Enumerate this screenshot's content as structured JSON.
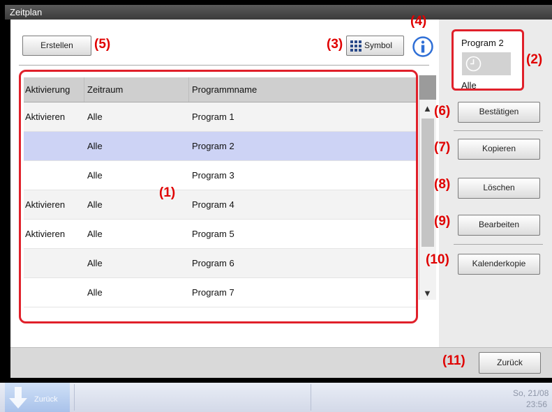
{
  "window": {
    "title": "Zeitplan"
  },
  "toolbar": {
    "create_label": "Erstellen",
    "symbol_label": "Symbol"
  },
  "table": {
    "columns": [
      "Aktivierung",
      "Zeitraum",
      "Programmname"
    ],
    "rows": [
      {
        "activation": "Aktivieren",
        "period": "Alle",
        "name": "Program 1"
      },
      {
        "activation": "",
        "period": "Alle",
        "name": "Program 2"
      },
      {
        "activation": "",
        "period": "Alle",
        "name": "Program 3"
      },
      {
        "activation": "Aktivieren",
        "period": "Alle",
        "name": "Program 4"
      },
      {
        "activation": "Aktivieren",
        "period": "Alle",
        "name": "Program 5"
      },
      {
        "activation": "",
        "period": "Alle",
        "name": "Program 6"
      },
      {
        "activation": "",
        "period": "Alle",
        "name": "Program 7"
      }
    ]
  },
  "info_box": {
    "program": "Program 2",
    "period": "Alle"
  },
  "buttons": {
    "confirm": "Bestätigen",
    "copy": "Kopieren",
    "delete": "Löschen",
    "edit": "Bearbeiten",
    "calendar_copy": "Kalenderkopie",
    "back": "Zurück"
  },
  "callouts": {
    "c1": "(1)",
    "c2": "(2)",
    "c3": "(3)",
    "c4": "(4)",
    "c5": "(5)",
    "c6": "(6)",
    "c7": "(7)",
    "c8": "(8)",
    "c9": "(9)",
    "c10": "(10)",
    "c11": "(11)"
  },
  "taskbar": {
    "back_label": "Zurück",
    "date": "So, 21/08",
    "time": "23:56"
  },
  "colors": {
    "accent_red": "#e0202a",
    "selected_row": "#cdd3f5",
    "info_blue": "#2f6fd6"
  }
}
